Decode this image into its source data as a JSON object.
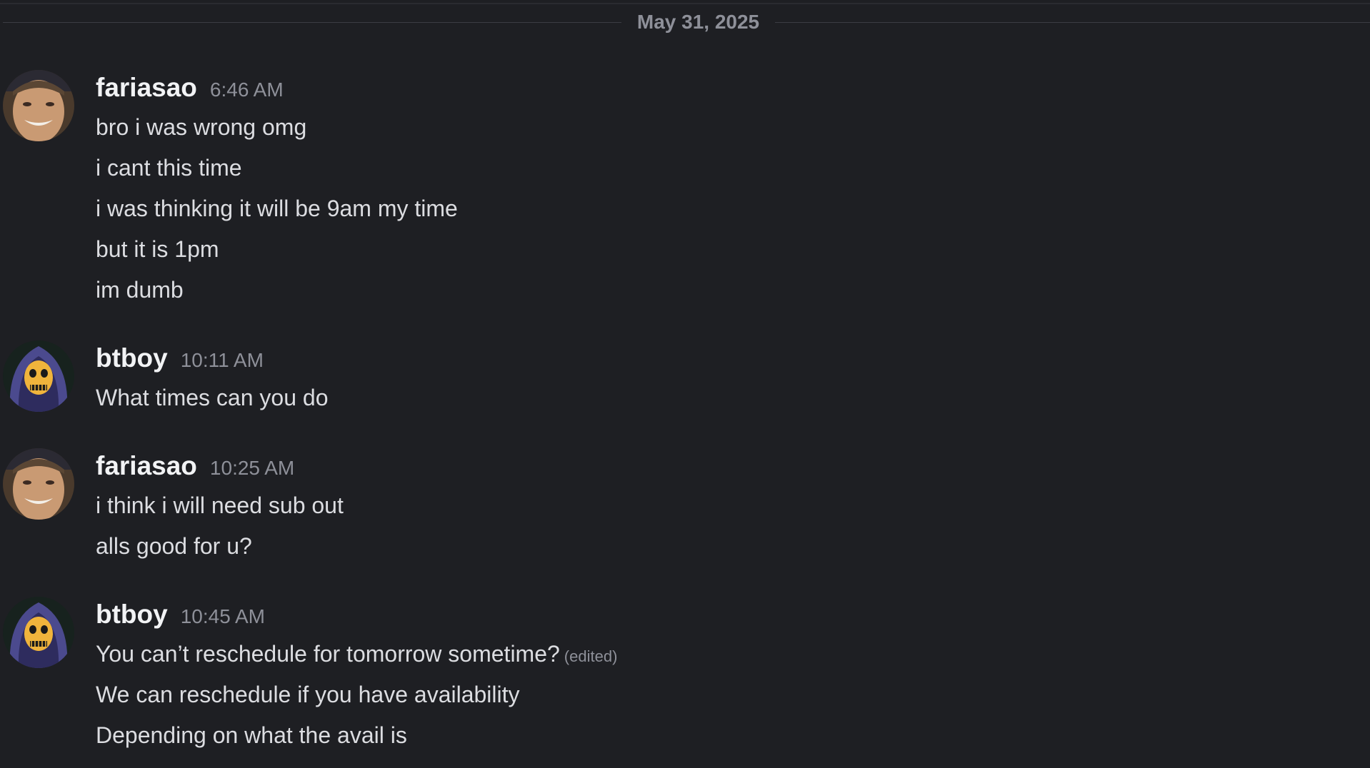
{
  "date_divider": "May 31, 2025",
  "messages": [
    {
      "author": "fariasao",
      "time": "6:46 AM",
      "avatar": "fariasao-avatar",
      "lines": [
        "bro i was wrong omg",
        "i cant this time",
        "i was thinking it will be 9am my time",
        "but it is 1pm",
        "im dumb"
      ]
    },
    {
      "author": "btboy",
      "time": "10:11 AM",
      "avatar": "btboy-avatar",
      "lines": [
        "What times can you do"
      ]
    },
    {
      "author": "fariasao",
      "time": "10:25 AM",
      "avatar": "fariasao-avatar",
      "lines": [
        "i think i will need sub out",
        "alls good for u?"
      ]
    },
    {
      "author": "btboy",
      "time": "10:45 AM",
      "avatar": "btboy-avatar",
      "lines": [
        "You can’t reschedule for tomorrow sometime?",
        "We can reschedule if you have availability",
        "Depending on what the avail is"
      ],
      "edited_label": "(edited)"
    }
  ]
}
